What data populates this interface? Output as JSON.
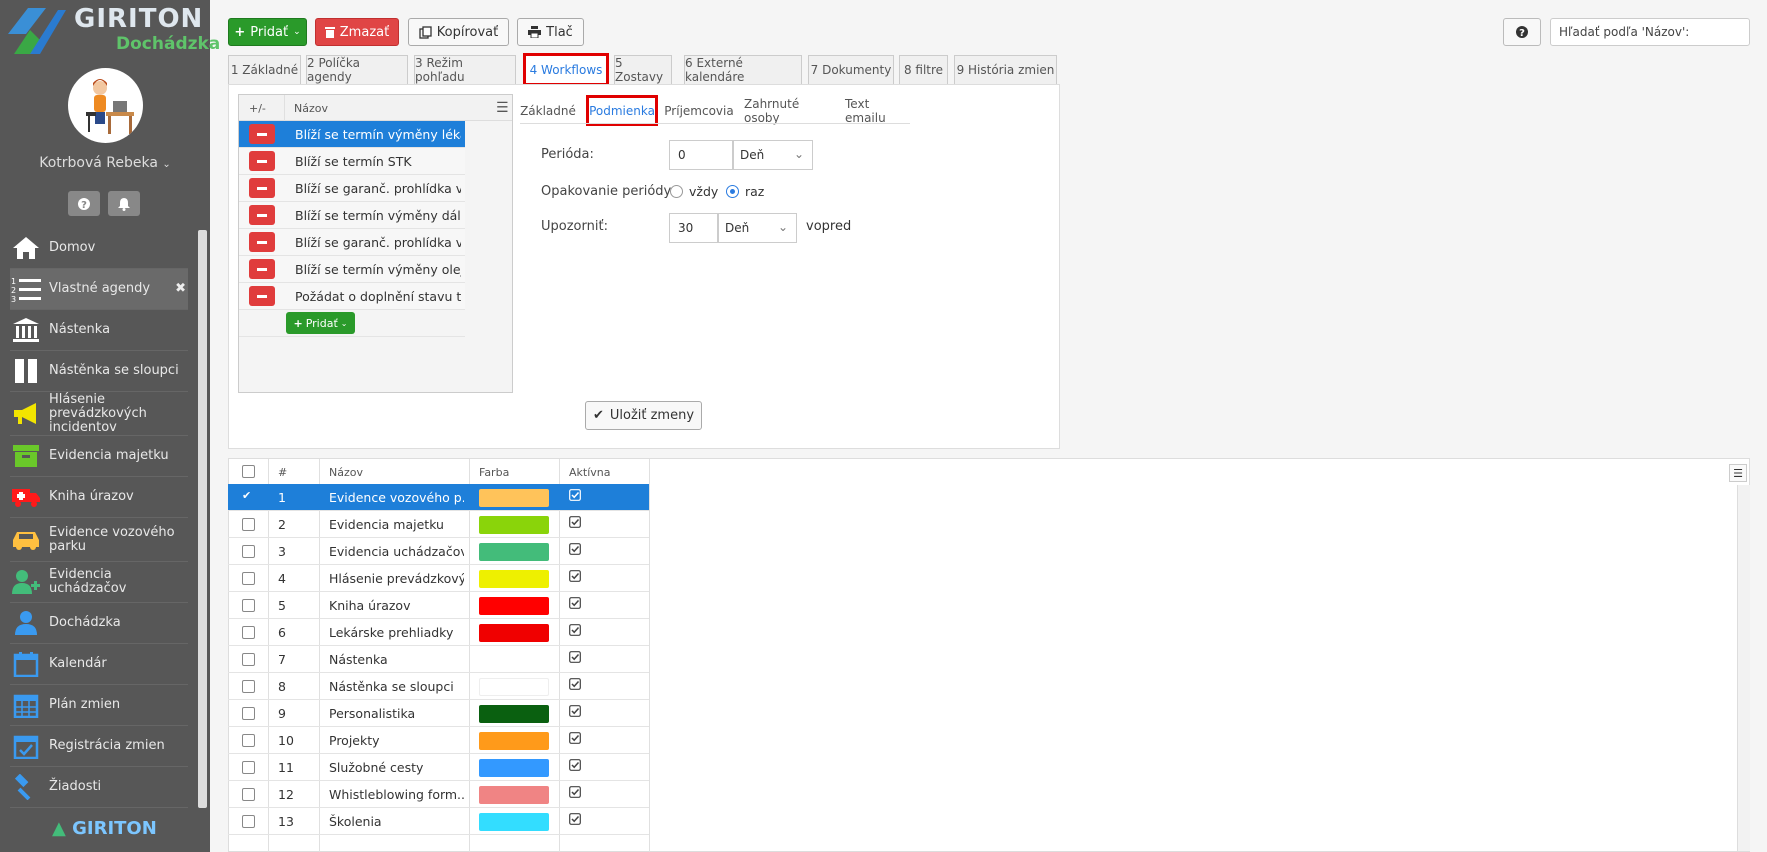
{
  "app": {
    "brand": "GIRITON",
    "product": "Dochádzka",
    "footer_brand": "GIRITON"
  },
  "user": {
    "name": "Kotrbová Rebeka"
  },
  "sidebar": {
    "items": [
      {
        "label": "Domov",
        "icon": "home-icon"
      },
      {
        "label": "Vlastné agendy",
        "icon": "numbered-list-icon",
        "active": true
      },
      {
        "label": "Nástenka",
        "icon": "bank-icon"
      },
      {
        "label": "Nástěnka se sloupci",
        "icon": "columns-icon"
      },
      {
        "label": "Hlásenie prevádzkových incidentov",
        "icon": "megaphone-icon"
      },
      {
        "label": "Evidencia majetku",
        "icon": "box-icon"
      },
      {
        "label": "Kniha úrazov",
        "icon": "ambulance-icon"
      },
      {
        "label": "Evidence vozového parku",
        "icon": "car-icon"
      },
      {
        "label": "Evidencia uchádzačov",
        "icon": "user-plus-icon"
      },
      {
        "label": "Dochádzka",
        "icon": "user-icon"
      },
      {
        "label": "Kalendár",
        "icon": "calendar-icon"
      },
      {
        "label": "Plán zmien",
        "icon": "calendar-grid-icon"
      },
      {
        "label": "Registrácia zmien",
        "icon": "calendar-check-icon"
      },
      {
        "label": "Žiadosti",
        "icon": "gavel-icon"
      }
    ]
  },
  "toolbar": {
    "add": "Pridať",
    "delete": "Zmazať",
    "copy": "Kopírovať",
    "print": "Tlač"
  },
  "search": {
    "placeholder": "Hľadať podľa 'Názov':"
  },
  "tabs": [
    "1 Základné",
    "2 Políčka agendy",
    "3 Režim pohľadu",
    "4 Workflows",
    "5 Zostavy",
    "6 Externé kalendáre",
    "7 Dokumenty",
    "8 filtre",
    "9 História zmien"
  ],
  "workflows": {
    "col_toggle": "+/-",
    "col_name": "Názov",
    "items": [
      "Blíží se termín výměny léká...",
      "Blíží se termín STK",
      "Blíží se garanč. prohlídka v...",
      "Blíží se termín výměny dál...",
      "Blíží se garanč. prohlídka v...",
      "Blíží se termín výměny oleje",
      "Požádat o doplnění stavu t..."
    ],
    "add": "Pridať"
  },
  "subtabs": [
    "Základné",
    "Podmienka",
    "Príjemcovia",
    "Zahrnuté osoby",
    "Text emailu"
  ],
  "condition": {
    "period_label": "Perióda:",
    "period_value": "0",
    "period_unit": "Deň",
    "repeat_label": "Opakovanie periódy:",
    "repeat_always": "vždy",
    "repeat_once": "raz",
    "notify_label": "Upozorniť:",
    "notify_value": "30",
    "notify_unit": "Deň",
    "notify_suffix": "vopred"
  },
  "save_label": "Uložiť zmeny",
  "agenda_table": {
    "columns": [
      "#",
      "Názov",
      "Farba",
      "Aktívna"
    ],
    "rows": [
      {
        "n": "1",
        "name": "Evidence vozového p...",
        "color": "#ffc35a"
      },
      {
        "n": "2",
        "name": "Evidencia majetku",
        "color": "#8ad40a"
      },
      {
        "n": "3",
        "name": "Evidencia uchádzačov",
        "color": "#43bc7a"
      },
      {
        "n": "4",
        "name": "Hlásenie prevádzkový...",
        "color": "#eef000"
      },
      {
        "n": "5",
        "name": "Kniha úrazov",
        "color": "#ff0000"
      },
      {
        "n": "6",
        "name": "Lekárske prehliadky",
        "color": "#f00000"
      },
      {
        "n": "7",
        "name": "Nástenka",
        "color": ""
      },
      {
        "n": "8",
        "name": "Nástěnka se sloupci",
        "color": "#ffffff"
      },
      {
        "n": "9",
        "name": "Personalistika",
        "color": "#0a6010"
      },
      {
        "n": "10",
        "name": "Projekty",
        "color": "#ff9a1a"
      },
      {
        "n": "11",
        "name": "Služobné cesty",
        "color": "#3399ff"
      },
      {
        "n": "12",
        "name": "Whistleblowing form...",
        "color": "#f08484"
      },
      {
        "n": "13",
        "name": "Školenia",
        "color": "#33ddff"
      }
    ]
  }
}
